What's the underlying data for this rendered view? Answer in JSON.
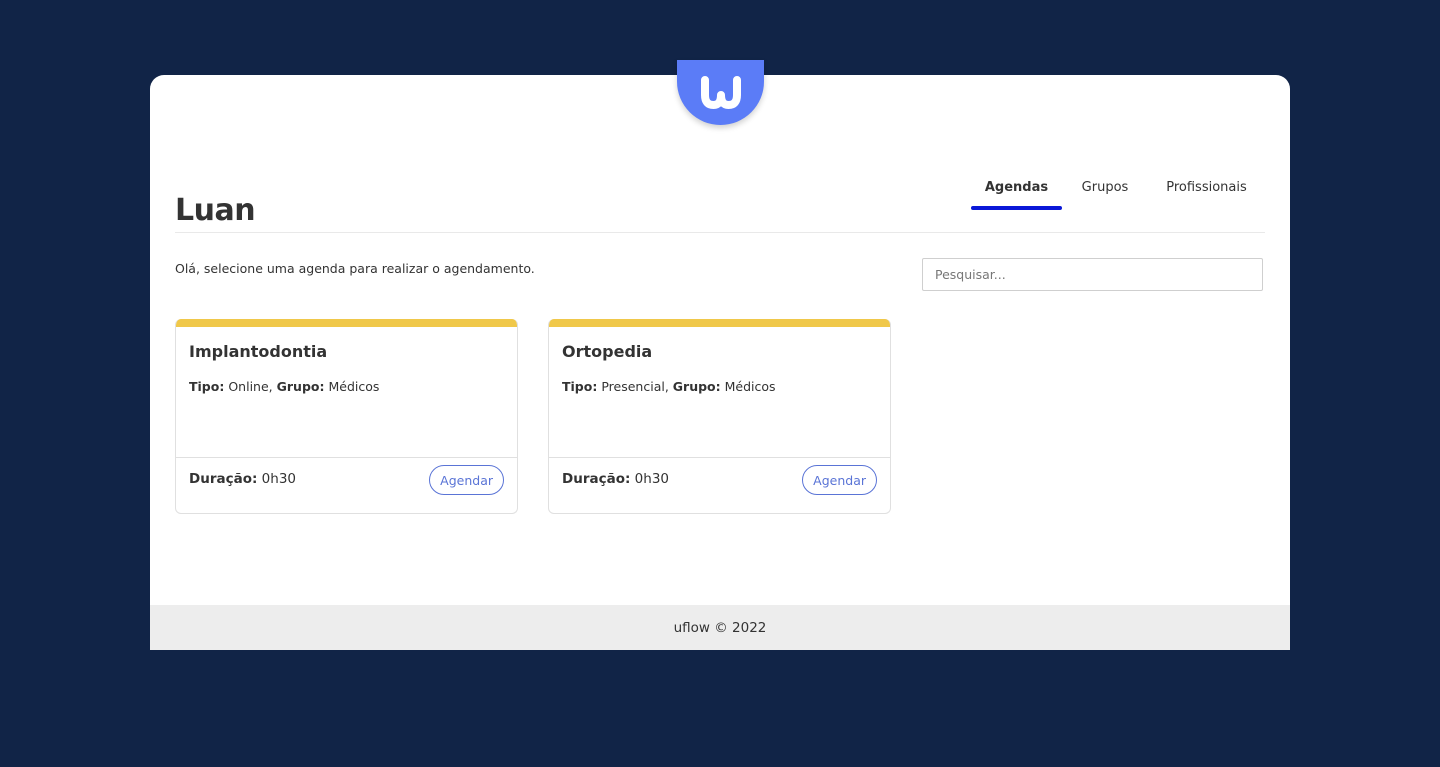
{
  "header": {
    "user_name": "Luan",
    "tabs": [
      {
        "label": "Agendas",
        "active": true
      },
      {
        "label": "Grupos",
        "active": false
      },
      {
        "label": "Profissionais",
        "active": false
      }
    ]
  },
  "logo": {
    "icon": "uflow-logo-icon",
    "color": "#5b7cf7"
  },
  "intro_text": "Olá, selecione uma agenda para realizar o agendamento.",
  "search": {
    "placeholder": "Pesquisar...",
    "value": ""
  },
  "cards": [
    {
      "title": "Implantodontia",
      "tipo_label": "Tipo:",
      "tipo_value": "Online",
      "grupo_label": "Grupo:",
      "grupo_value": "Médicos",
      "duracao_label": "Duração:",
      "duracao_value": "0h30",
      "button_label": "Agendar"
    },
    {
      "title": "Ortopedia",
      "tipo_label": "Tipo:",
      "tipo_value": "Presencial",
      "grupo_label": "Grupo:",
      "grupo_value": "Médicos",
      "duracao_label": "Duração:",
      "duracao_value": "0h30",
      "button_label": "Agendar"
    }
  ],
  "footer": {
    "text": "uflow © 2022"
  },
  "colors": {
    "background": "#112447",
    "accent": "#5b7cf7",
    "tab_indicator": "#0a18d8",
    "card_bar": "#f0c84a",
    "button": "#5a74d6"
  }
}
